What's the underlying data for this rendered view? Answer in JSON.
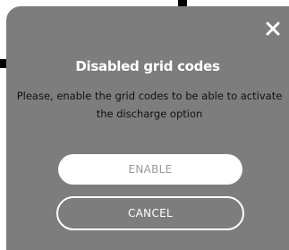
{
  "dialog": {
    "title": "Disabled grid codes",
    "message": "Please, enable the grid codes to be able to activate the discharge option",
    "close_icon": "close-icon",
    "enable_label": "ENABLE",
    "cancel_label": "CANCEL"
  },
  "colors": {
    "overlay_background": "#7d7d7d",
    "title_text": "#ffffff",
    "message_text": "#111111",
    "enable_button_bg": "#ffffff",
    "enable_button_text": "#9a9a9a",
    "cancel_button_border": "#ffffff",
    "cancel_button_text": "#ffffff"
  }
}
